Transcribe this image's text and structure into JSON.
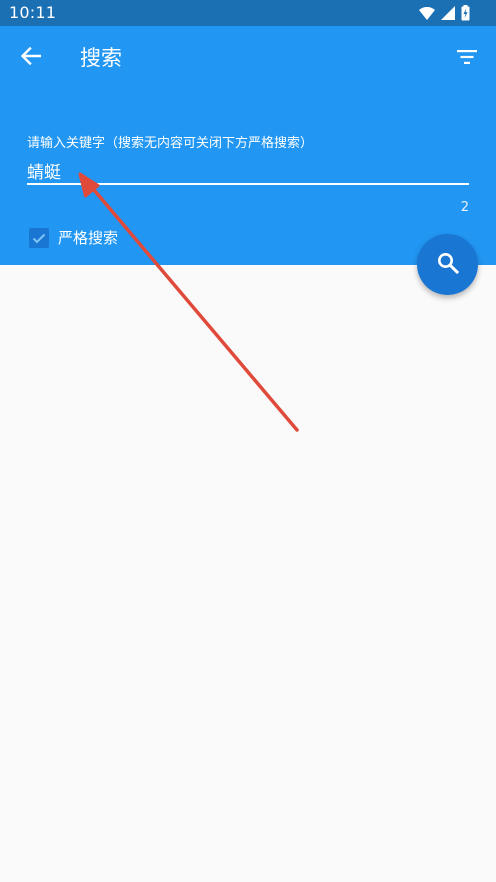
{
  "status_bar": {
    "time": "10:11",
    "icons": [
      "wifi-icon",
      "signal-icon",
      "battery-charging-icon"
    ]
  },
  "app_bar": {
    "title": "搜索",
    "back_icon": "arrow-back-icon",
    "filter_icon": "filter-list-icon"
  },
  "search_form": {
    "label": "请输入关键字（搜索无内容可关闭下方严格搜索）",
    "value": "蜻蜓",
    "char_count": "2",
    "strict_search": {
      "label": "严格搜索",
      "checked": true
    }
  },
  "fab": {
    "icon": "search-icon"
  },
  "colors": {
    "status_bar": "#1b6fb3",
    "primary": "#2196f3",
    "accent": "#1976d2",
    "background": "#fafafa",
    "annotation_arrow": "#e04a3a"
  }
}
